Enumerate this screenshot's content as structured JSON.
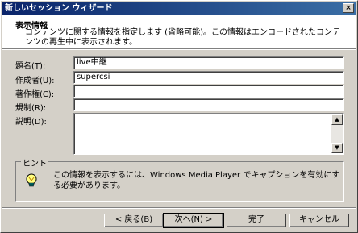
{
  "window": {
    "title": "新しいセッション ウィザード",
    "close_glyph": "×"
  },
  "header": {
    "title": "表示情報",
    "description": "コンテンツに関する情報を指定します (省略可能)。この情報はエンコードされたコンテンツの再生中に表示されます。"
  },
  "form": {
    "title_label": "題名(T):",
    "title_value": "live中継",
    "author_label": "作成者(U):",
    "author_value": "supercsi",
    "copyright_label": "著作権(C):",
    "copyright_value": "",
    "rating_label": "規制(R):",
    "rating_value": "",
    "description_label": "説明(D):",
    "description_value": ""
  },
  "hint": {
    "legend": "ヒント",
    "text": "この情報を表示するには、Windows Media Player でキャプションを有効にする必要があります。",
    "icon": "lightbulb-icon"
  },
  "buttons": {
    "back": "< 戻る(B)",
    "next": "次へ(N) >",
    "finish": "完了",
    "cancel": "キャンセル"
  },
  "colors": {
    "titlebar": "#0a246a",
    "face": "#d4d0c8"
  }
}
